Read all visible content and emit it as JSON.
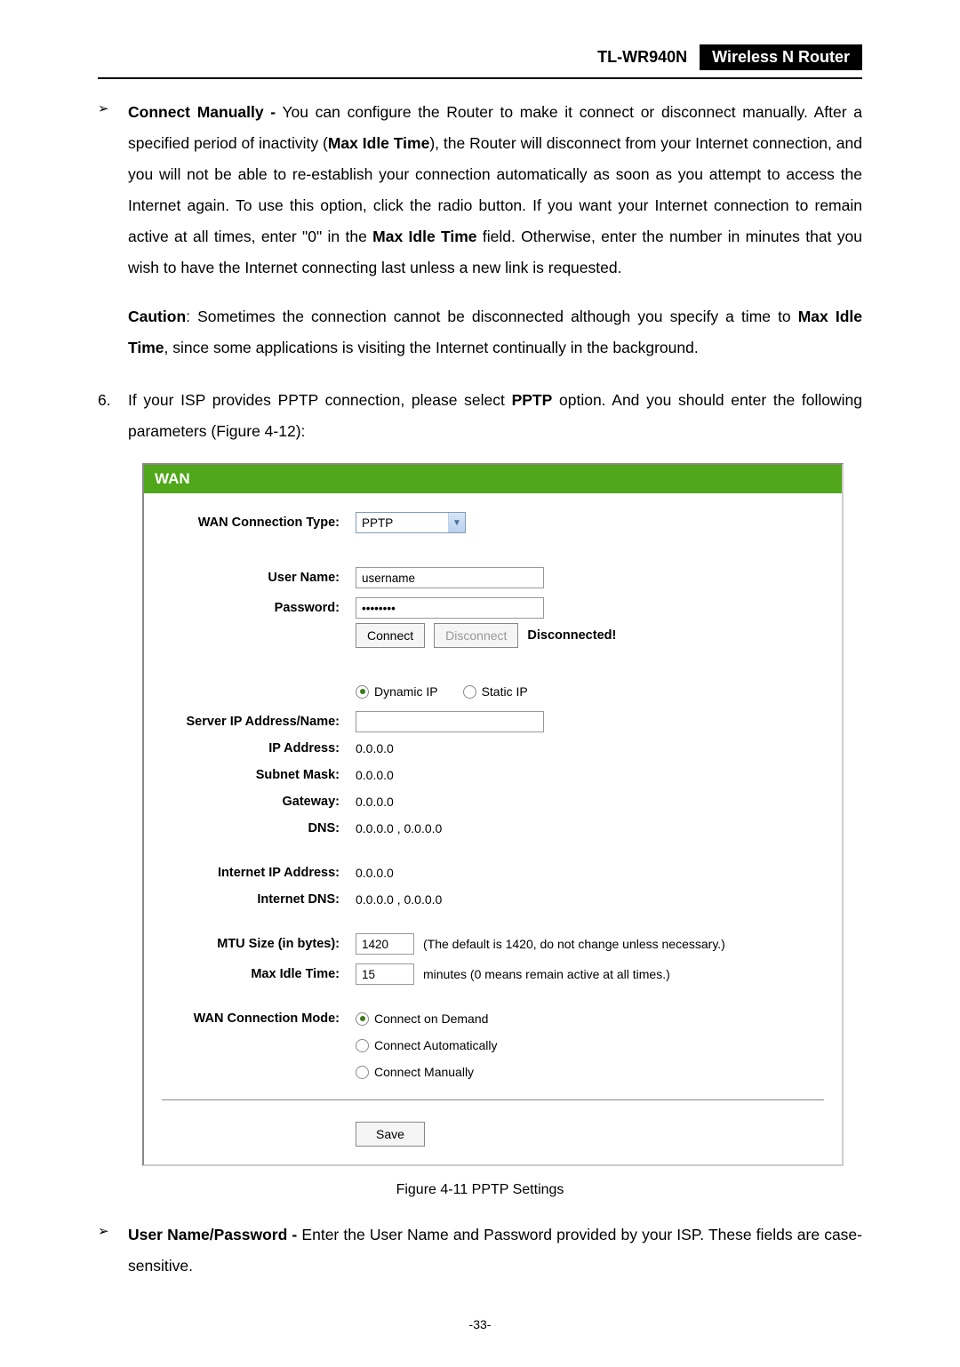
{
  "header": {
    "model": "TL-WR940N",
    "desc": "Wireless  N  Router"
  },
  "bullet1": {
    "title": "Connect Manually -",
    "body": " You can configure the Router to make it connect or disconnect manually. After a specified period of inactivity (",
    "bold_mid1": "Max Idle Time",
    "body2": "), the Router will disconnect from your Internet connection, and you will not be able to re-establish your connection automatically as soon as you attempt to access the Internet again. To use this option, click the radio button. If you want your Internet connection to remain active at all times, enter \"0\" in the ",
    "bold_mid2": "Max Idle Time",
    "body3": " field. Otherwise, enter the number in minutes that you wish to have the Internet connecting last unless a new link is requested."
  },
  "caution": {
    "lead": "Caution",
    "body": ": Sometimes the connection cannot be disconnected although you specify a time to ",
    "bold_mid": "Max Idle Time",
    "body2": ", since some applications is visiting the Internet continually in the background."
  },
  "step6": {
    "num": "6.",
    "body1": "If your ISP provides PPTP connection, please select ",
    "bold_mid": "PPTP",
    "body2": " option. And you should enter the following parameters (Figure 4-12):"
  },
  "figure": {
    "title": "WAN",
    "labels": {
      "wan_conn_type": "WAN Connection Type:",
      "user_name": "User Name:",
      "password": "Password:",
      "server_ip": "Server IP Address/Name:",
      "ip_addr": "IP Address:",
      "subnet": "Subnet Mask:",
      "gateway": "Gateway:",
      "dns": "DNS:",
      "internet_ip": "Internet IP Address:",
      "internet_dns": "Internet DNS:",
      "mtu": "MTU Size (in bytes):",
      "max_idle": "Max Idle Time:",
      "wan_mode": "WAN Connection Mode:"
    },
    "values": {
      "wan_conn_type": "PPTP",
      "user_name": "username",
      "password": "••••••••",
      "ip_addr": "0.0.0.0",
      "subnet": "0.0.0.0",
      "gateway": "0.0.0.0",
      "dns": "0.0.0.0 , 0.0.0.0",
      "internet_ip": "0.0.0.0",
      "internet_dns": "0.0.0.0 , 0.0.0.0",
      "mtu": "1420",
      "max_idle": "15"
    },
    "buttons": {
      "connect": "Connect",
      "disconnect": "Disconnect",
      "save": "Save"
    },
    "status": "Disconnected!",
    "radio_ip": {
      "dynamic": "Dynamic IP",
      "static": "Static IP"
    },
    "radio_mode": {
      "demand": "Connect on Demand",
      "auto": "Connect Automatically",
      "manual": "Connect Manually"
    },
    "hints": {
      "mtu": "(The default is 1420, do not change unless necessary.)",
      "max_idle": "minutes (0 means remain active at all times.)"
    }
  },
  "figure_caption": "Figure 4-11    PPTP Settings",
  "bullet2": {
    "title": "User Name/Password -",
    "body": " Enter the User Name and Password provided by your ISP. These fields are case-sensitive."
  },
  "page_number": "-33-"
}
